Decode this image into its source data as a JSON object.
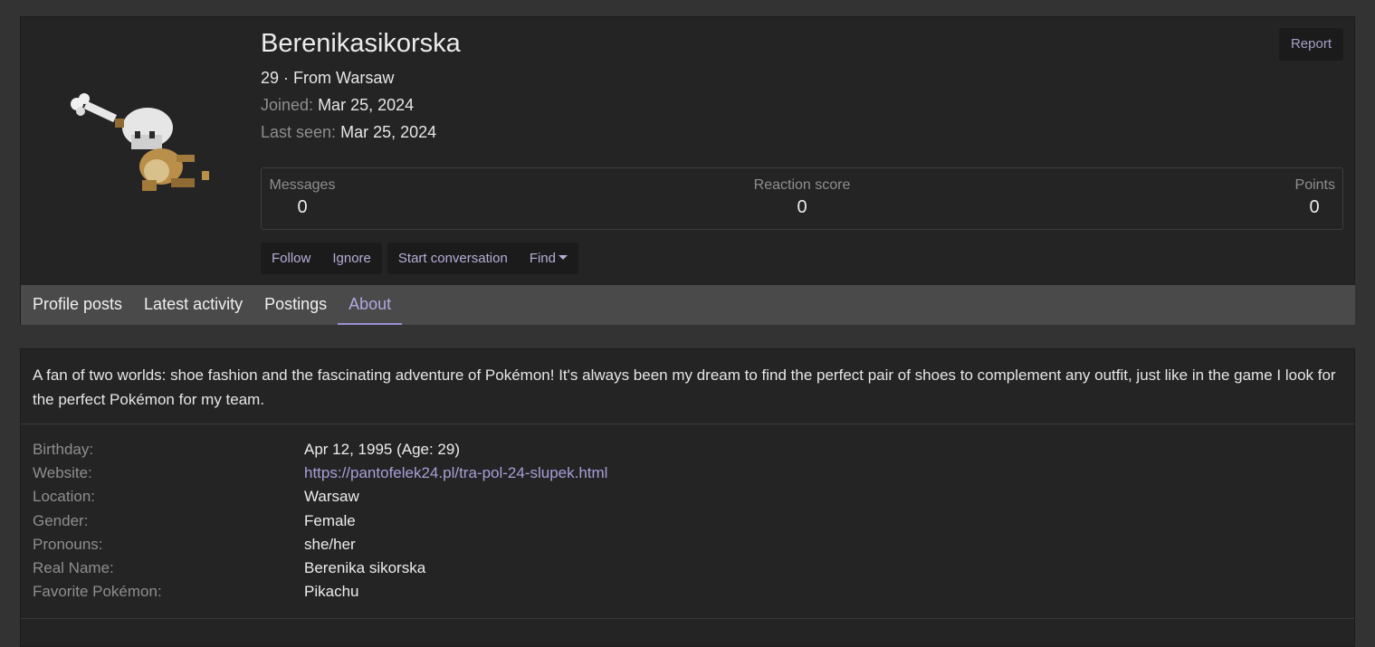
{
  "profile": {
    "username": "Berenikasikorska",
    "age_location": "29 · From Warsaw",
    "joined_label": "Joined:",
    "joined_value": "Mar 25, 2024",
    "last_seen_label": "Last seen:",
    "last_seen_value": "Mar 25, 2024",
    "report_label": "Report",
    "avatar_icon": "marowak-sprite-icon"
  },
  "stats": {
    "messages_label": "Messages",
    "messages_value": "0",
    "reaction_label": "Reaction score",
    "reaction_value": "0",
    "points_label": "Points",
    "points_value": "0"
  },
  "actions": {
    "follow": "Follow",
    "ignore": "Ignore",
    "start_conversation": "Start conversation",
    "find": "Find"
  },
  "tabs": [
    {
      "label": "Profile posts"
    },
    {
      "label": "Latest activity"
    },
    {
      "label": "Postings"
    },
    {
      "label": "About"
    }
  ],
  "about": {
    "bio": "A fan of two worlds: shoe fashion and the fascinating adventure of Pokémon! It's always been my dream to find the perfect pair of shoes to complement any outfit, just like in the game I look for the perfect Pokémon for my team.",
    "fields": [
      {
        "label": "Birthday:",
        "value": "Apr 12, 1995 (Age: 29)"
      },
      {
        "label": "Website:",
        "value": "https://pantofelek24.pl/tra-pol-24-slupek.html"
      },
      {
        "label": "Location:",
        "value": "Warsaw"
      },
      {
        "label": "Gender:",
        "value": "Female"
      },
      {
        "label": "Pronouns:",
        "value": "she/her"
      },
      {
        "label": "Real Name:",
        "value": "Berenika sikorska"
      },
      {
        "label": "Favorite Pokémon:",
        "value": "Pikachu"
      }
    ]
  },
  "colors": {
    "background": "#333333",
    "card": "#242424",
    "accent": "#9c8fd4",
    "link": "#a89fd8"
  }
}
